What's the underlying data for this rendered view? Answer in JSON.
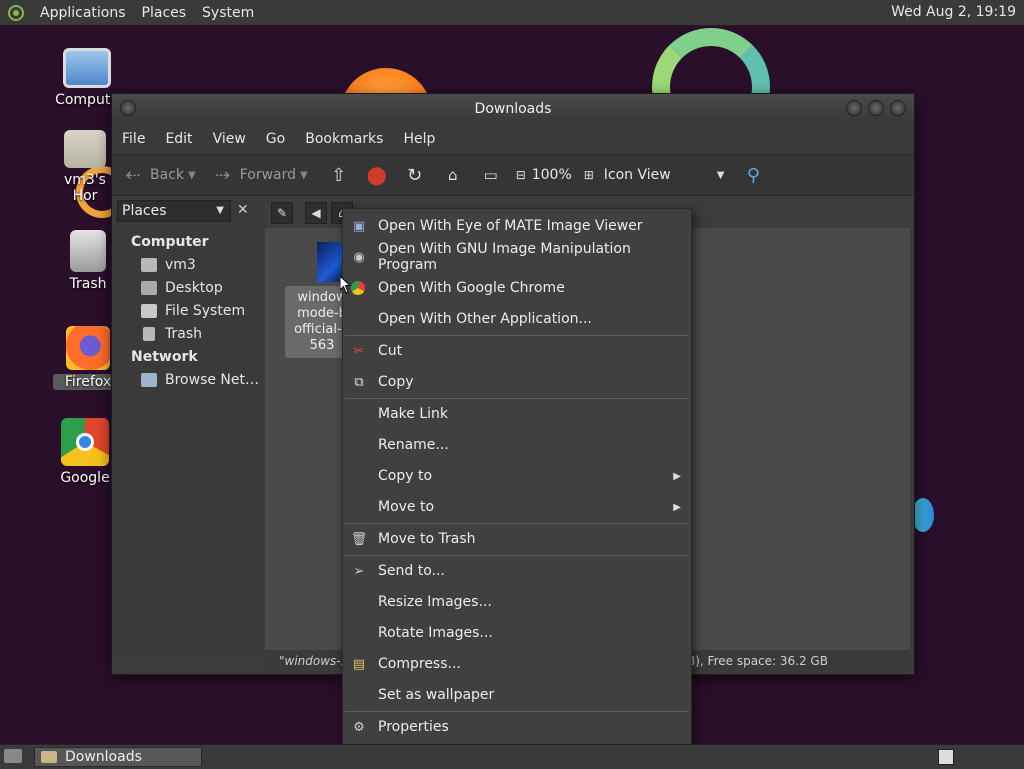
{
  "top_panel": {
    "menus": [
      "Applications",
      "Places",
      "System"
    ],
    "clock": "Wed Aug  2, 19:19"
  },
  "desktop": {
    "icons": [
      {
        "label": "Compute"
      },
      {
        "label": "vm3's Hor"
      },
      {
        "label": "Trash"
      },
      {
        "label": "Firefox"
      },
      {
        "label": "Google"
      }
    ]
  },
  "window": {
    "title": "Downloads",
    "menubar": [
      "File",
      "Edit",
      "View",
      "Go",
      "Bookmarks",
      "Help"
    ],
    "toolbar": {
      "back": "Back",
      "forward": "Forward",
      "zoom": "100%",
      "view_mode": "Icon View"
    },
    "sidebar": {
      "selector": "Places",
      "computer_heading": "Computer",
      "computer_items": [
        "vm3",
        "Desktop",
        "File System",
        "Trash"
      ],
      "network_heading": "Network",
      "network_items": [
        "Browse Net…"
      ]
    },
    "file": {
      "label_lines": [
        "window",
        "mode-b",
        "official-3",
        "563"
      ]
    },
    "status_left": "\"windows-11",
    "status_right": "B), Free space: 36.2 GB"
  },
  "context_menu": {
    "items": [
      {
        "label": "Open With Eye of MATE Image Viewer",
        "icon": "image-viewer-icon"
      },
      {
        "label": "Open With GNU Image Manipulation Program",
        "icon": "gimp-icon"
      },
      {
        "label": "Open With Google Chrome",
        "icon": "chrome-icon"
      },
      {
        "label": "Open With Other Application...",
        "icon": ""
      },
      {
        "label": "Cut",
        "icon": "scissors-icon"
      },
      {
        "label": "Copy",
        "icon": "copy-icon"
      },
      {
        "label": "Make Link",
        "icon": ""
      },
      {
        "label": "Rename...",
        "icon": ""
      },
      {
        "label": "Copy to",
        "icon": "",
        "submenu": true
      },
      {
        "label": "Move to",
        "icon": "",
        "submenu": true
      },
      {
        "label": "Move to Trash",
        "icon": "trash-icon"
      },
      {
        "label": "Send to...",
        "icon": "send-icon"
      },
      {
        "label": "Resize Images...",
        "icon": ""
      },
      {
        "label": "Rotate Images...",
        "icon": ""
      },
      {
        "label": "Compress...",
        "icon": "archive-icon"
      },
      {
        "label": "Set as wallpaper",
        "icon": ""
      },
      {
        "label": "Properties",
        "icon": "properties-icon"
      }
    ]
  },
  "bottom_panel": {
    "task_label": "Downloads"
  },
  "colors": {
    "desktop_bg": "#2a0f2b",
    "panel_bg": "#3a3a3a",
    "menu_bg": "#404040"
  }
}
